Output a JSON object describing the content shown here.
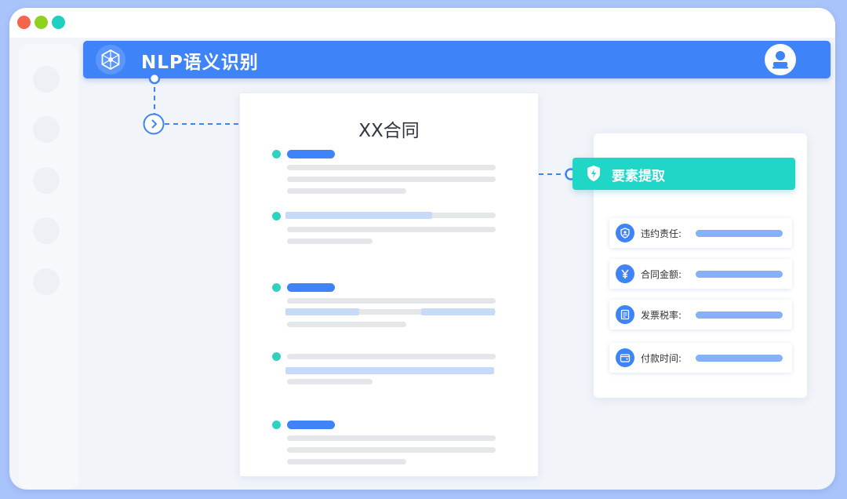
{
  "window": {
    "controls": [
      "close",
      "minimize",
      "maximize"
    ]
  },
  "topbar": {
    "title": "NLP语义识别",
    "logo_icon": "network-hexagon-icon",
    "avatar_icon": "user-avatar-icon",
    "color": "#3f83f8"
  },
  "document": {
    "title": "XX合同"
  },
  "extraction": {
    "header_label": "要素提取",
    "header_icon": "shield-icon",
    "header_color": "#20d6c7",
    "fields": [
      {
        "label": "违约责任:",
        "icon": "user-shield-icon"
      },
      {
        "label": "合同金额:",
        "icon": "yen-icon"
      },
      {
        "label": "发票税率:",
        "icon": "receipt-icon"
      },
      {
        "label": "付款时间:",
        "icon": "wallet-icon"
      }
    ]
  }
}
